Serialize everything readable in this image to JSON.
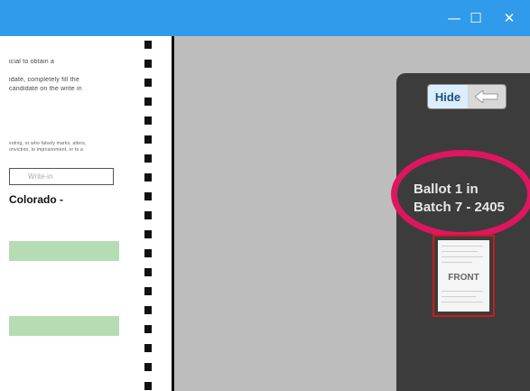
{
  "window": {
    "minimize_glyph": "—",
    "maximize_glyph": "☐",
    "close_glyph": "✕"
  },
  "ballot": {
    "lines": [
      "icial to obtain a",
      "idate, completely fill the",
      "candidate on the write in",
      "voting, or who falsely marks, alters,",
      "onviction, to imprisonment, or to a"
    ],
    "write_in_text": "Write-in",
    "heading": "Colorado -"
  },
  "panel": {
    "hide_label": "Hide",
    "ballot_line_1": "Ballot 1 in",
    "ballot_line_2": "Batch 7 - 2405",
    "thumbnail_label": "FRONT"
  },
  "colors": {
    "titlebar": "#2f9bea",
    "highlight": "#e0155f",
    "thumb_border": "#c51d1d",
    "panel": "#3c3c3c",
    "green_bar": "#b5dcb2"
  }
}
